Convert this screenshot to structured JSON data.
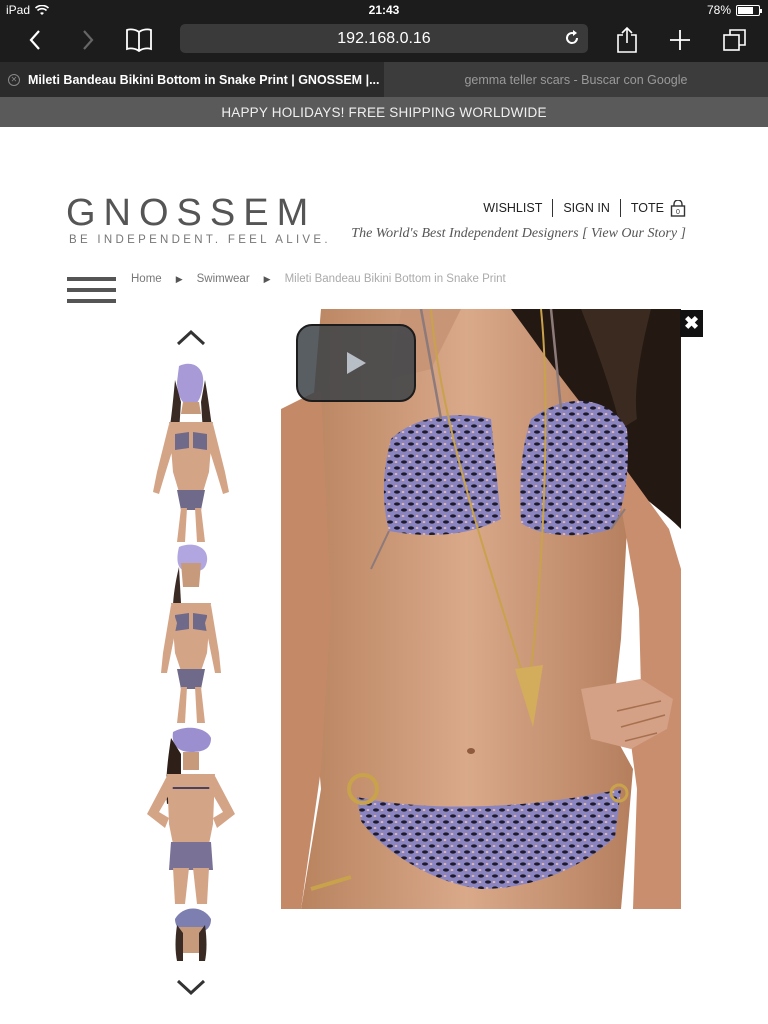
{
  "status": {
    "device": "iPad",
    "time": "21:43",
    "battery": "78%",
    "battery_level": 0.78
  },
  "browser": {
    "address": "192.168.0.16",
    "tabs": [
      {
        "title": "Mileti Bandeau Bikini Bottom in Snake Print | GNOSSEM |...",
        "active": true
      },
      {
        "title": "gemma teller scars - Buscar con Google",
        "active": false
      }
    ]
  },
  "promo": "HAPPY HOLIDAYS! FREE SHIPPING WORLDWIDE",
  "header": {
    "logo": "GNOSSEM",
    "tagline": "BE INDEPENDENT. FEEL ALIVE.",
    "nav": {
      "wishlist": "WISHLIST",
      "signin": "SIGN IN",
      "tote": "TOTE"
    },
    "story_prefix": "The World's Best Independent Designers",
    "story_link": "[ View Our Story ]"
  },
  "breadcrumb": {
    "home": "Home",
    "category": "Swimwear",
    "current": "Mileti Bandeau Bikini Bottom in Snake Print"
  },
  "gallery": {
    "close_label": "✖"
  },
  "colors": {
    "status_bar": "#1c1c1c",
    "promo_bar": "#5a5a5a",
    "logo": "#555555",
    "print_purple": "#8a84c0"
  }
}
